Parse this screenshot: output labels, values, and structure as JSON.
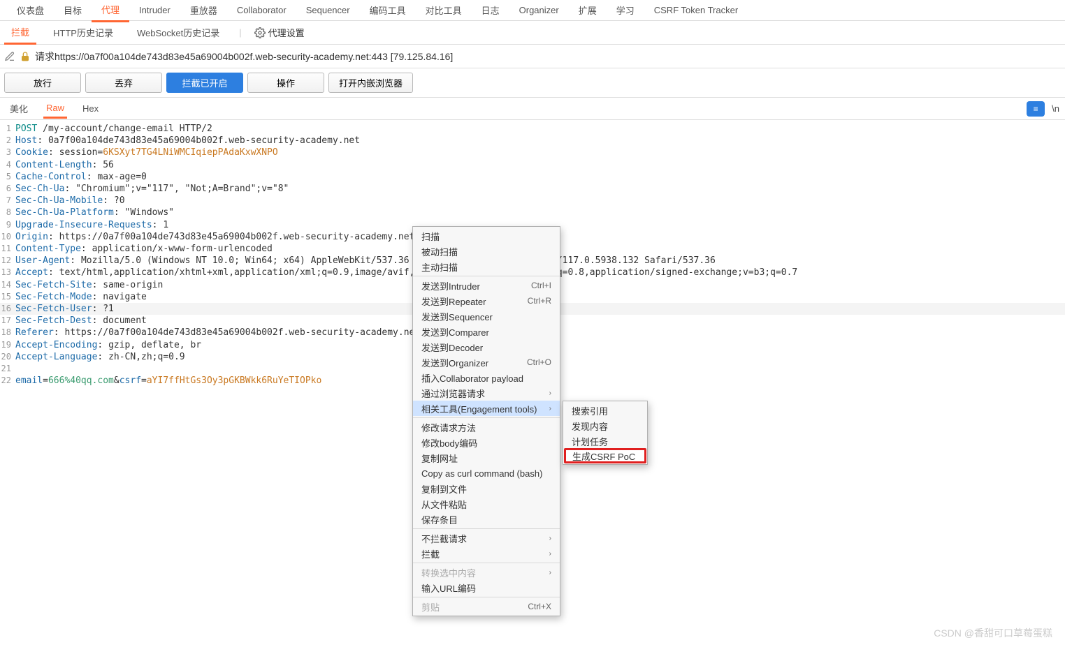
{
  "topTabs": [
    "仪表盘",
    "目标",
    "代理",
    "Intruder",
    "重放器",
    "Collaborator",
    "Sequencer",
    "编码工具",
    "对比工具",
    "日志",
    "Organizer",
    "扩展",
    "学习",
    "CSRF Token Tracker"
  ],
  "topActive": 2,
  "subTabs": {
    "items": [
      "拦截",
      "HTTP历史记录",
      "WebSocket历史记录"
    ],
    "proxy": "代理设置"
  },
  "urlRow": {
    "prefix": "请求",
    "url": "https://0a7f00a104de743d83e45a69004b002f.web-security-academy.net:443",
    "ip": "[79.125.84.16]"
  },
  "buttons": {
    "forward": "放行",
    "drop": "丢弃",
    "intercept": "拦截已开启",
    "action": "操作",
    "browser": "打开内嵌浏览器"
  },
  "viewTabs": [
    "美化",
    "Raw",
    "Hex"
  ],
  "rightBadge": "\\n",
  "request": {
    "lines": [
      {
        "n": 1,
        "prefix": "POST",
        "rest": " /my-account/change-email HTTP/2",
        "cls": "val-teal"
      },
      {
        "n": 2,
        "h": "Host",
        "v": "0a7f00a104de743d83e45a69004b002f.web-security-academy.net"
      },
      {
        "n": 3,
        "h": "Cookie",
        "raw": " session=",
        "cookie": "6KSXyt7TG4LNiWMCIqiepPAdaKxwXNPO"
      },
      {
        "n": 4,
        "h": "Content-Length",
        "v": "56"
      },
      {
        "n": 5,
        "h": "Cache-Control",
        "v": "max-age=0"
      },
      {
        "n": 6,
        "h": "Sec-Ch-Ua",
        "v": "\"Chromium\";v=\"117\", \"Not;A=Brand\";v=\"8\""
      },
      {
        "n": 7,
        "h": "Sec-Ch-Ua-Mobile",
        "v": "?0"
      },
      {
        "n": 8,
        "h": "Sec-Ch-Ua-Platform",
        "v": "\"Windows\""
      },
      {
        "n": 9,
        "h": "Upgrade-Insecure-Requests",
        "v": "1"
      },
      {
        "n": 10,
        "h": "Origin",
        "v": "https://0a7f00a104de743d83e45a69004b002f.web-security-academy.net"
      },
      {
        "n": 11,
        "h": "Content-Type",
        "v": "application/x-www-form-urlencoded"
      },
      {
        "n": 12,
        "h": "User-Agent",
        "v": "Mozilla/5.0 (Windows NT 10.0; Win64; x64) AppleWebKit/537.36 (KHTML, like Gecko) Chrome/117.0.5938.132 Safari/537.36"
      },
      {
        "n": 13,
        "h": "Accept",
        "v": "text/html,application/xhtml+xml,application/xml;q=0.9,image/avif,image/webp,image/apng,*/*;q=0.8,application/signed-exchange;v=b3;q=0.7"
      },
      {
        "n": 14,
        "h": "Sec-Fetch-Site",
        "v": "same-origin"
      },
      {
        "n": 15,
        "h": "Sec-Fetch-Mode",
        "v": "navigate"
      },
      {
        "n": 16,
        "h": "Sec-Fetch-User",
        "v": "?1",
        "hl": true
      },
      {
        "n": 17,
        "h": "Sec-Fetch-Dest",
        "v": "document"
      },
      {
        "n": 18,
        "h": "Referer",
        "v": "https://0a7f00a104de743d83e45a69004b002f.web-security-academy.net/my-"
      },
      {
        "n": 19,
        "h": "Accept-Encoding",
        "v": "gzip, deflate, br"
      },
      {
        "n": 20,
        "h": "Accept-Language",
        "v": "zh-CN,zh;q=0.9"
      },
      {
        "n": 21,
        "blank": true
      },
      {
        "n": 22,
        "body": {
          "p1": "email",
          "eq": "=",
          "v1": "666%40qq.com",
          "amp": "&",
          "p2": "csrf",
          "v2": "aYI7ffHtGs3Oy3pGKBWkk6RuYeTIOPko"
        }
      }
    ]
  },
  "ctx": {
    "items": [
      {
        "t": "扫描"
      },
      {
        "t": "被动扫描"
      },
      {
        "t": "主动扫描"
      },
      {
        "sep": true
      },
      {
        "t": "发送到Intruder",
        "s": "Ctrl+I"
      },
      {
        "t": "发送到Repeater",
        "s": "Ctrl+R"
      },
      {
        "t": "发送到Sequencer"
      },
      {
        "t": "发送到Comparer"
      },
      {
        "t": "发送到Decoder"
      },
      {
        "t": "发送到Organizer",
        "s": "Ctrl+O"
      },
      {
        "t": "插入Collaborator payload"
      },
      {
        "t": "通过浏览器请求",
        "sub": true
      },
      {
        "t": "相关工具(Engagement tools)",
        "sub": true,
        "hl": true
      },
      {
        "sep": true
      },
      {
        "t": "修改请求方法"
      },
      {
        "t": "修改body编码"
      },
      {
        "t": "复制网址"
      },
      {
        "t": "Copy as curl command (bash)"
      },
      {
        "t": "复制到文件"
      },
      {
        "t": "从文件粘贴"
      },
      {
        "t": "保存条目"
      },
      {
        "sep": true
      },
      {
        "t": "不拦截请求",
        "sub": true
      },
      {
        "t": "拦截",
        "sub": true
      },
      {
        "sep": true
      },
      {
        "t": "转换选中内容",
        "sub": true,
        "dis": true
      },
      {
        "t": "输入URL编码"
      },
      {
        "sep": true
      },
      {
        "t": "剪贴",
        "s": "Ctrl+X",
        "dis": true
      }
    ]
  },
  "submenu": [
    "搜索引用",
    "发现内容",
    "计划任务",
    "生成CSRF PoC"
  ],
  "watermark": "CSDN @香甜可口草莓蛋糕"
}
